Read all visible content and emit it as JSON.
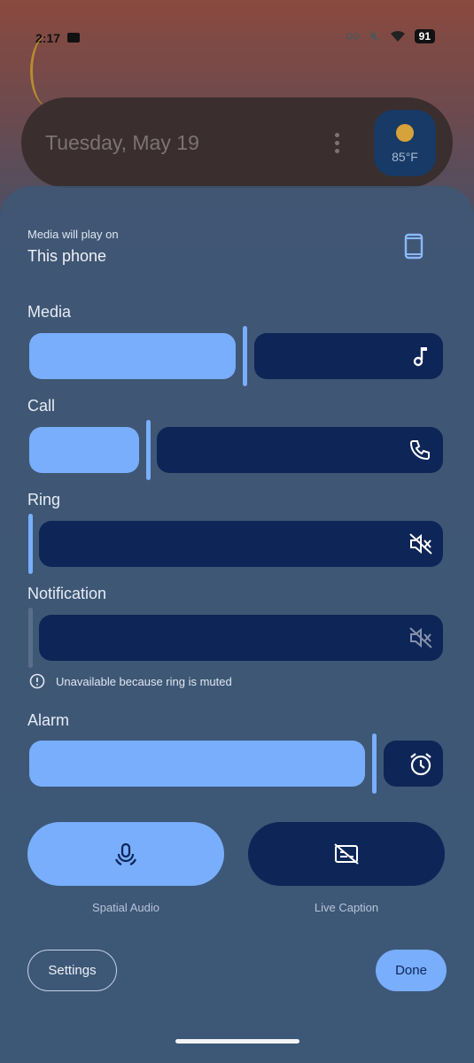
{
  "status": {
    "time": "2:17",
    "battery": "91"
  },
  "date_card": {
    "date": "Tuesday, May 19",
    "temperature": "85°F"
  },
  "output": {
    "label": "Media will play on",
    "device": "This phone"
  },
  "sliders": {
    "media": {
      "label": "Media",
      "level": 0.52
    },
    "call": {
      "label": "Call",
      "level": 0.28
    },
    "ring": {
      "label": "Ring",
      "level": 0.0
    },
    "notification": {
      "label": "Notification",
      "level": 0.0,
      "note": "Unavailable because ring is muted"
    },
    "alarm": {
      "label": "Alarm",
      "level": 0.85
    }
  },
  "toggles": {
    "spatial_audio": "Spatial Audio",
    "live_caption": "Live Caption"
  },
  "footer": {
    "settings": "Settings",
    "done": "Done"
  },
  "colors": {
    "accent": "#78aefc",
    "track": "#0e2557",
    "panel": "#3c5878"
  }
}
